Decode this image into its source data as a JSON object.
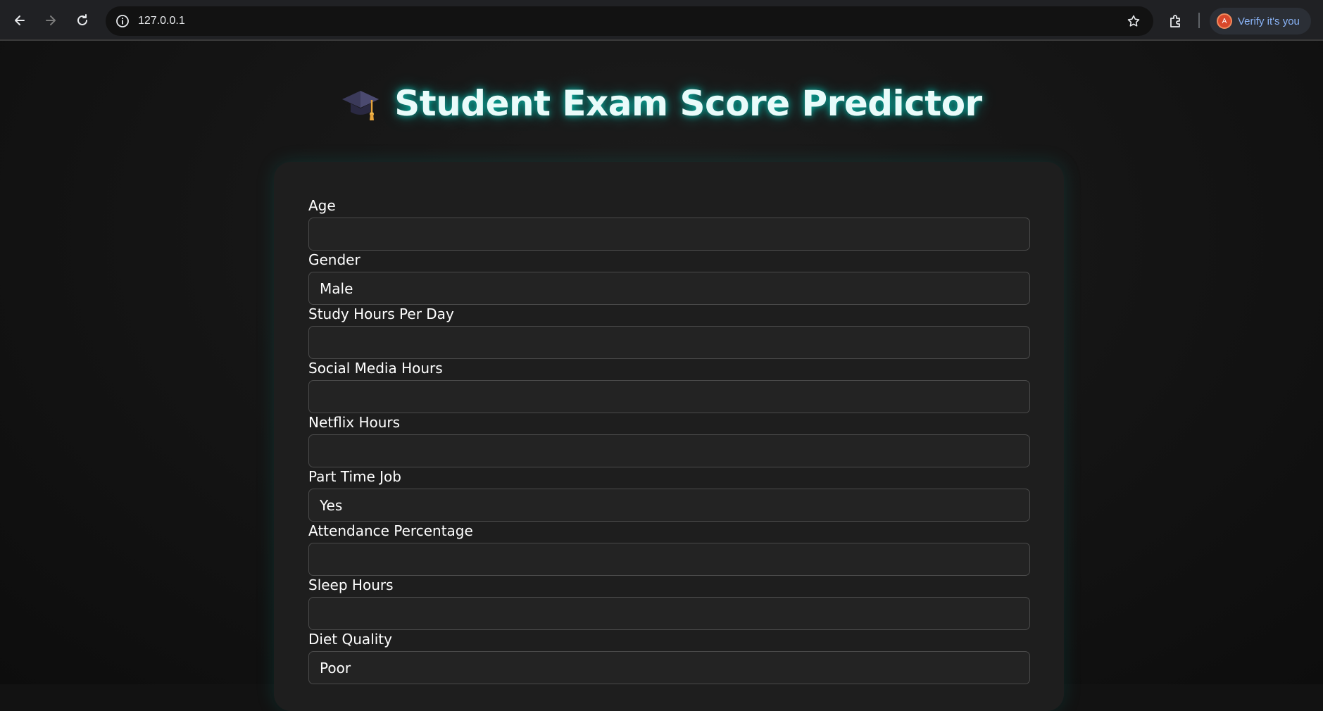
{
  "browser": {
    "url": "127.0.0.1",
    "verify_label": "Verify it's you",
    "avatar_letter": "A"
  },
  "page": {
    "icon": "graduation-cap-icon",
    "title": "Student Exam Score Predictor",
    "accent_color": "#00e6d2"
  },
  "form": {
    "fields": [
      {
        "label": "Age",
        "value": ""
      },
      {
        "label": "Gender",
        "value": "Male"
      },
      {
        "label": "Study Hours Per Day",
        "value": ""
      },
      {
        "label": "Social Media Hours",
        "value": ""
      },
      {
        "label": "Netflix Hours",
        "value": ""
      },
      {
        "label": "Part Time Job",
        "value": "Yes"
      },
      {
        "label": "Attendance Percentage",
        "value": ""
      },
      {
        "label": "Sleep Hours",
        "value": ""
      },
      {
        "label": "Diet Quality",
        "value": "Poor"
      }
    ]
  }
}
